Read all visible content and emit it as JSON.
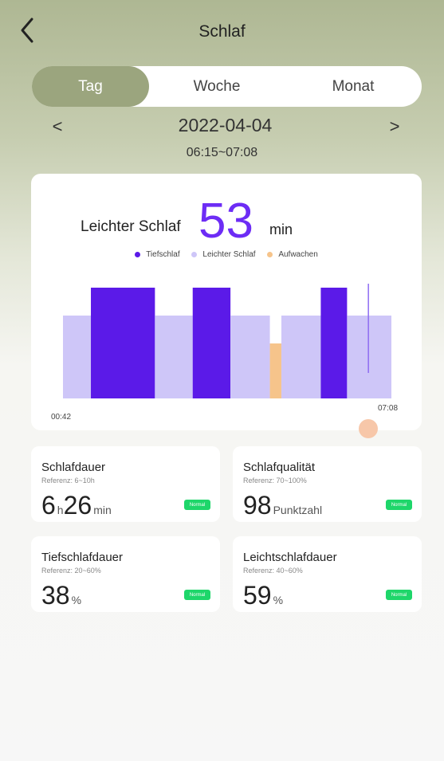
{
  "header": {
    "title": "Schlaf"
  },
  "tabs": [
    {
      "label": "Tag",
      "active": true
    },
    {
      "label": "Woche",
      "active": false
    },
    {
      "label": "Monat",
      "active": false
    }
  ],
  "date_nav": {
    "prev": "<",
    "next": ">",
    "date": "2022-04-04",
    "time_range": "06:15~07:08"
  },
  "summary": {
    "label": "Leichter Schlaf",
    "value": "53",
    "unit": "min"
  },
  "legend": [
    {
      "label": "Tiefschlaf",
      "color": "#5b1ae8"
    },
    {
      "label": "Leichter Schlaf",
      "color": "#cec6f8"
    },
    {
      "label": "Aufwachen",
      "color": "#f6c48b"
    }
  ],
  "chart_data": {
    "type": "bar",
    "x_start": "00:42",
    "x_end": "07:08",
    "stage_levels": {
      "Tiefschlaf": 3,
      "Leichter Schlaf": 2,
      "Aufwachen": 1
    },
    "segments": [
      {
        "stage": "Leichter Schlaf",
        "start": 0.0,
        "end": 0.085
      },
      {
        "stage": "Tiefschlaf",
        "start": 0.085,
        "end": 0.28
      },
      {
        "stage": "Leichter Schlaf",
        "start": 0.28,
        "end": 0.395
      },
      {
        "stage": "Tiefschlaf",
        "start": 0.395,
        "end": 0.51
      },
      {
        "stage": "Leichter Schlaf",
        "start": 0.51,
        "end": 0.63
      },
      {
        "stage": "Aufwachen",
        "start": 0.63,
        "end": 0.665
      },
      {
        "stage": "Leichter Schlaf",
        "start": 0.665,
        "end": 0.785
      },
      {
        "stage": "Tiefschlaf",
        "start": 0.785,
        "end": 0.865
      },
      {
        "stage": "Leichter Schlaf",
        "start": 0.865,
        "end": 1.0
      }
    ],
    "cursor_position": 0.93
  },
  "stats": [
    {
      "title": "Schlafdauer",
      "ref": "Referenz: 6~10h",
      "parts": [
        {
          "text": "6",
          "size": "big"
        },
        {
          "text": "h",
          "size": "small"
        },
        {
          "text": "26",
          "size": "big"
        },
        {
          "text": "min",
          "size": "small"
        }
      ],
      "badge": "Normal"
    },
    {
      "title": "Schlafqualität",
      "ref": "Referenz: 70~100%",
      "parts": [
        {
          "text": "98",
          "size": "big"
        },
        {
          "text": "Punktzahl",
          "size": "small"
        }
      ],
      "badge": "Normal"
    },
    {
      "title": "Tiefschlafdauer",
      "ref": "Referenz: 20~60%",
      "parts": [
        {
          "text": "38",
          "size": "big"
        },
        {
          "text": "%",
          "size": "small"
        }
      ],
      "badge": "Normal"
    },
    {
      "title": "Leichtschlafdauer",
      "ref": "Referenz: 40~60%",
      "parts": [
        {
          "text": "59",
          "size": "big"
        },
        {
          "text": "%",
          "size": "small"
        }
      ],
      "badge": "Normal"
    }
  ]
}
